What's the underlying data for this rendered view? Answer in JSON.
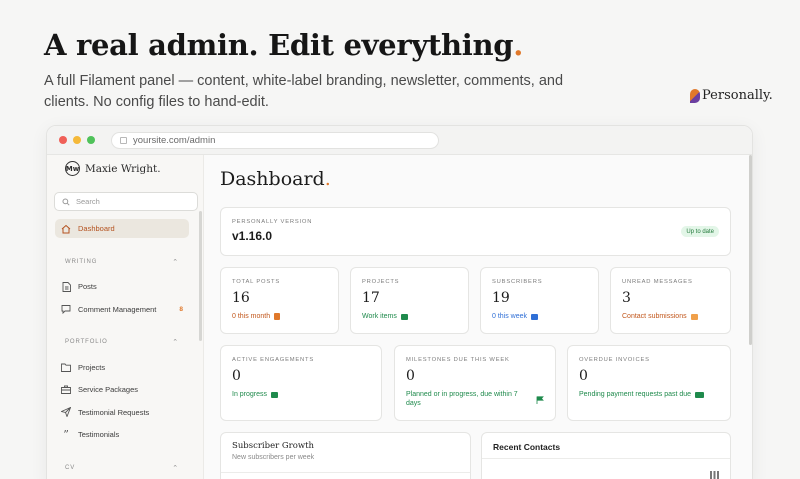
{
  "hero": {
    "title": "A real admin. Edit everything",
    "title_dot": ".",
    "subtitle": "A full Filament panel — content, white-label branding, newsletter, comments, and clients. No config files to hand-edit.",
    "brand": "Personally."
  },
  "browser": {
    "url": "yoursite.com/admin"
  },
  "sidebar": {
    "brand": "Maxie Wright.",
    "logo_text": "Mw",
    "search_placeholder": "Search",
    "items_top": [
      {
        "label": "Dashboard",
        "icon": "home-icon",
        "active": true
      }
    ],
    "groups": [
      {
        "label": "WRITING",
        "items": [
          {
            "label": "Posts",
            "icon": "document-icon"
          },
          {
            "label": "Comment Management",
            "icon": "chat-icon",
            "badge": "8"
          }
        ]
      },
      {
        "label": "PORTFOLIO",
        "items": [
          {
            "label": "Projects",
            "icon": "folder-icon"
          },
          {
            "label": "Service Packages",
            "icon": "briefcase-icon"
          },
          {
            "label": "Testimonial Requests",
            "icon": "send-icon"
          },
          {
            "label": "Testimonials",
            "icon": "quote-icon"
          }
        ]
      },
      {
        "label": "CV",
        "items": []
      }
    ]
  },
  "main": {
    "title": "Dashboard",
    "title_dot": ".",
    "version": {
      "label": "PERSONALLY VERSION",
      "value": "v1.16.0",
      "status": "Up to date",
      "status_color": "#237a3c"
    },
    "stats_row1": [
      {
        "label": "TOTAL POSTS",
        "value": "16",
        "desc": "0 this month",
        "color": "#c2571c",
        "icon": "document-icon"
      },
      {
        "label": "PROJECTS",
        "value": "17",
        "desc": "Work items",
        "color": "#1f8a4c",
        "icon": "folder-icon"
      },
      {
        "label": "SUBSCRIBERS",
        "value": "19",
        "desc": "0 this week",
        "color": "#2f6fd6",
        "icon": "mail-icon"
      },
      {
        "label": "UNREAD MESSAGES",
        "value": "3",
        "desc": "Contact submissions",
        "color": "#c2571c",
        "icon": "inbox-icon"
      }
    ],
    "stats_row2": [
      {
        "label": "ACTIVE ENGAGEMENTS",
        "value": "0",
        "desc": "In progress",
        "color": "#1f8a4c",
        "icon": "briefcase-icon"
      },
      {
        "label": "MILESTONES DUE THIS WEEK",
        "value": "0",
        "desc": "Planned or in progress, due within 7 days",
        "color": "#1f8a4c",
        "icon": "flag-icon"
      },
      {
        "label": "OVERDUE INVOICES",
        "value": "0",
        "desc": "Pending payment requests past due",
        "color": "#1f8a4c",
        "icon": "banknote-icon"
      }
    ],
    "panels": [
      {
        "title": "Subscriber Growth",
        "subtitle": "New subscribers per week"
      },
      {
        "title": "Recent Contacts",
        "subtitle": ""
      }
    ]
  }
}
